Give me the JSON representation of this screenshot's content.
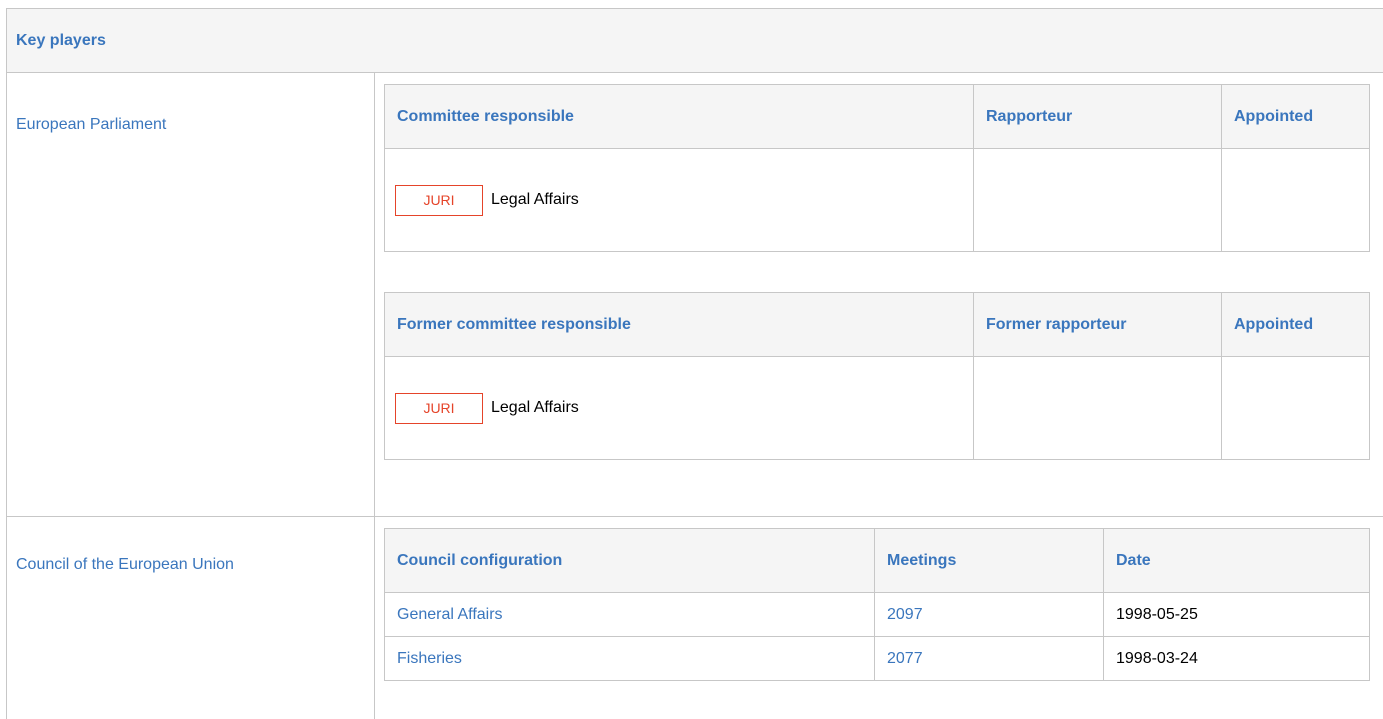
{
  "header": {
    "title": "Key players"
  },
  "parliament": {
    "label": "European Parliament",
    "committee_table": {
      "headers": [
        "Committee responsible",
        "Rapporteur",
        "Appointed"
      ],
      "row": {
        "badge": "JURI",
        "name": "Legal Affairs"
      }
    },
    "former_table": {
      "headers": [
        "Former committee responsible",
        "Former rapporteur",
        "Appointed"
      ],
      "row": {
        "badge": "JURI",
        "name": "Legal Affairs"
      }
    }
  },
  "council": {
    "label": "Council of the European Union",
    "table": {
      "headers": [
        "Council configuration",
        "Meetings",
        "Date"
      ],
      "rows": [
        {
          "configuration": "General Affairs",
          "meeting": "2097",
          "date": "1998-05-25"
        },
        {
          "configuration": "Fisheries",
          "meeting": "2077",
          "date": "1998-03-24"
        }
      ]
    }
  },
  "colors": {
    "link": "#3a76bd",
    "badge": "#e5442a",
    "border": "#c7c7c7",
    "header_bg": "#f5f5f5"
  }
}
